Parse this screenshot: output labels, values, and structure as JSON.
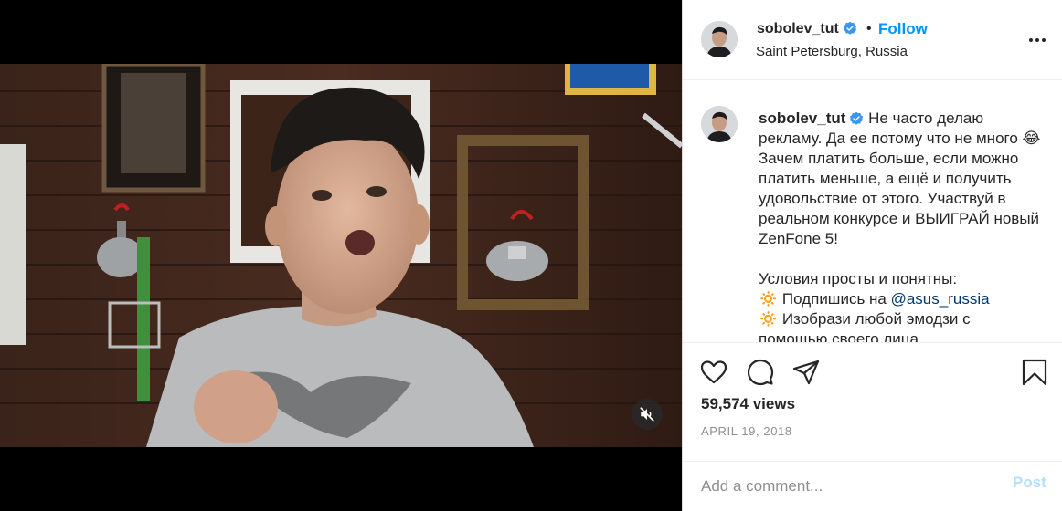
{
  "post": {
    "username": "sobolev_tut",
    "verified": true,
    "dot": "•",
    "follow_label": "Follow",
    "location": "Saint Petersburg, Russia"
  },
  "caption": {
    "username": "sobolev_tut",
    "text_1": " Не часто делаю рекламу. Да ее потому что не много 😂Зачем платить больше, если можно платить меньше, а ещё и получить удовольствие от этого. Участвуй в реальном конкурсе и ВЫИГРАЙ новый ZenFone 5!\n\nУсловия просты и понятны:\n🔅 Подпишись на ",
    "mention": "@asus_russia",
    "text_2": "\n🔅 Изобрази любой эмодзи с помощью своего лица"
  },
  "stats": {
    "views": "59,574 views",
    "date": "APRIL 19, 2018"
  },
  "comment": {
    "placeholder": "Add a comment...",
    "post_label": "Post"
  },
  "icons": {
    "verified": "verified-badge-icon",
    "more": "more-options-icon",
    "like": "heart-icon",
    "comment": "comment-icon",
    "share": "paper-plane-icon",
    "save": "bookmark-icon",
    "mute": "muted-speaker-icon"
  },
  "colors": {
    "link": "#0095f6",
    "mention": "#00376b",
    "post_disabled": "#b2dffc",
    "muted_text": "#8e8e8e"
  }
}
